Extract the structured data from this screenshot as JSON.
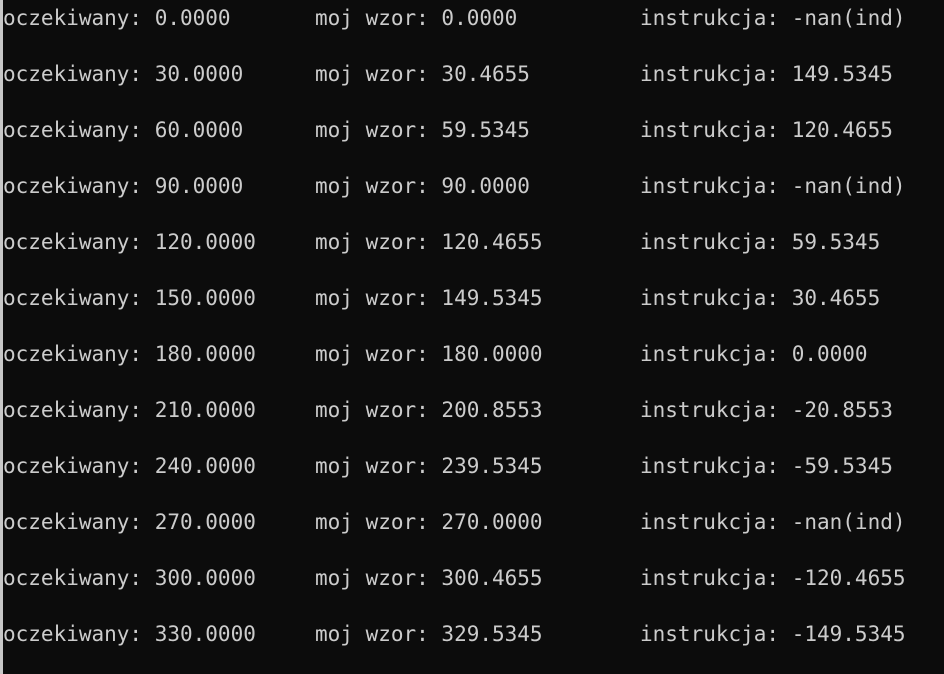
{
  "terminal": {
    "rows": [
      {
        "col1": "oczekiwany: 0.0000",
        "col2": "moj wzor: 0.0000",
        "col3": "instrukcja: -nan(ind)"
      },
      {
        "col1": "oczekiwany: 30.0000",
        "col2": "moj wzor: 30.4655",
        "col3": "instrukcja: 149.5345"
      },
      {
        "col1": "oczekiwany: 60.0000",
        "col2": "moj wzor: 59.5345",
        "col3": "instrukcja: 120.4655"
      },
      {
        "col1": "oczekiwany: 90.0000",
        "col2": "moj wzor: 90.0000",
        "col3": "instrukcja: -nan(ind)"
      },
      {
        "col1": "oczekiwany: 120.0000",
        "col2": "moj wzor: 120.4655",
        "col3": "instrukcja: 59.5345"
      },
      {
        "col1": "oczekiwany: 150.0000",
        "col2": "moj wzor: 149.5345",
        "col3": "instrukcja: 30.4655"
      },
      {
        "col1": "oczekiwany: 180.0000",
        "col2": "moj wzor: 180.0000",
        "col3": "instrukcja: 0.0000"
      },
      {
        "col1": "oczekiwany: 210.0000",
        "col2": "moj wzor: 200.8553",
        "col3": "instrukcja: -20.8553"
      },
      {
        "col1": "oczekiwany: 240.0000",
        "col2": "moj wzor: 239.5345",
        "col3": "instrukcja: -59.5345"
      },
      {
        "col1": "oczekiwany: 270.0000",
        "col2": "moj wzor: 270.0000",
        "col3": "instrukcja: -nan(ind)"
      },
      {
        "col1": "oczekiwany: 300.0000",
        "col2": "moj wzor: 300.4655",
        "col3": "instrukcja: -120.4655"
      },
      {
        "col1": "oczekiwany: 330.0000",
        "col2": "moj wzor: 329.5345",
        "col3": "instrukcja: -149.5345"
      }
    ]
  },
  "colors": {
    "background": "#0c0c0c",
    "foreground": "#cccccc"
  }
}
